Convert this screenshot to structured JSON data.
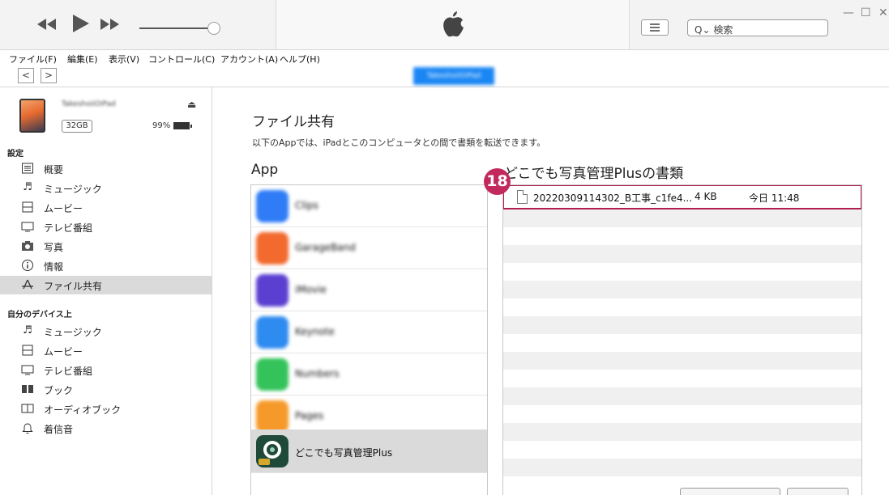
{
  "player": {
    "rewind_icon": "rewind-icon",
    "play_icon": "play-icon",
    "forward_icon": "fast-forward-icon",
    "logo": "apple-logo"
  },
  "search": {
    "placeholder": "検索"
  },
  "menu": [
    "ファイル(F)",
    "編集(E)",
    "表示(V)",
    "コントロール(C)",
    "アカウント(A)",
    "ヘルプ(H)"
  ],
  "nav": {
    "back": "<",
    "forward": ">",
    "device_pill": "TakeshoiiOiPad"
  },
  "device": {
    "name": "TakeshoiiOiPad",
    "capacity": "32GB",
    "battery": "99%"
  },
  "sidebar": {
    "settings_head": "設定",
    "settings_items": [
      {
        "label": "概要",
        "icon": "summary-icon"
      },
      {
        "label": "ミュージック",
        "icon": "music-note-icon"
      },
      {
        "label": "ムービー",
        "icon": "film-icon"
      },
      {
        "label": "テレビ番組",
        "icon": "tv-icon"
      },
      {
        "label": "写真",
        "icon": "camera-icon"
      },
      {
        "label": "情報",
        "icon": "info-icon"
      },
      {
        "label": "ファイル共有",
        "icon": "app-store-icon",
        "selected": true
      }
    ],
    "device_head": "自分のデバイス上",
    "device_items": [
      {
        "label": "ミュージック",
        "icon": "music-note-icon"
      },
      {
        "label": "ムービー",
        "icon": "film-icon"
      },
      {
        "label": "テレビ番組",
        "icon": "tv-icon"
      },
      {
        "label": "ブック",
        "icon": "book-icon"
      },
      {
        "label": "オーディオブック",
        "icon": "audiobook-icon"
      },
      {
        "label": "着信音",
        "icon": "bell-icon"
      }
    ]
  },
  "main": {
    "title": "ファイル共有",
    "description": "以下のAppでは、iPadとこのコンピュータとの間で書類を転送できます。",
    "apps_head": "App",
    "docs_head": "どこでも写真管理Plusの書類",
    "step_badge": "18"
  },
  "apps": [
    {
      "name": "Clips",
      "color": "#2f7cf6",
      "blur": true
    },
    {
      "name": "GarageBand",
      "color": "#f26a2e",
      "blur": true
    },
    {
      "name": "iMovie",
      "color": "#5b3fd1",
      "blur": true
    },
    {
      "name": "Keynote",
      "color": "#2e8bf0",
      "blur": true
    },
    {
      "name": "Numbers",
      "color": "#33c35a",
      "blur": true
    },
    {
      "name": "Pages",
      "color": "#f59a2a",
      "blur": true
    },
    {
      "name": "どこでも写真管理Plus",
      "color": "#1f4a3a",
      "blur": false,
      "selected": true
    }
  ],
  "document": {
    "filename": "20220309114302_B工事_c1fe4...",
    "size": "4 KB",
    "date": "今日 11:48"
  }
}
